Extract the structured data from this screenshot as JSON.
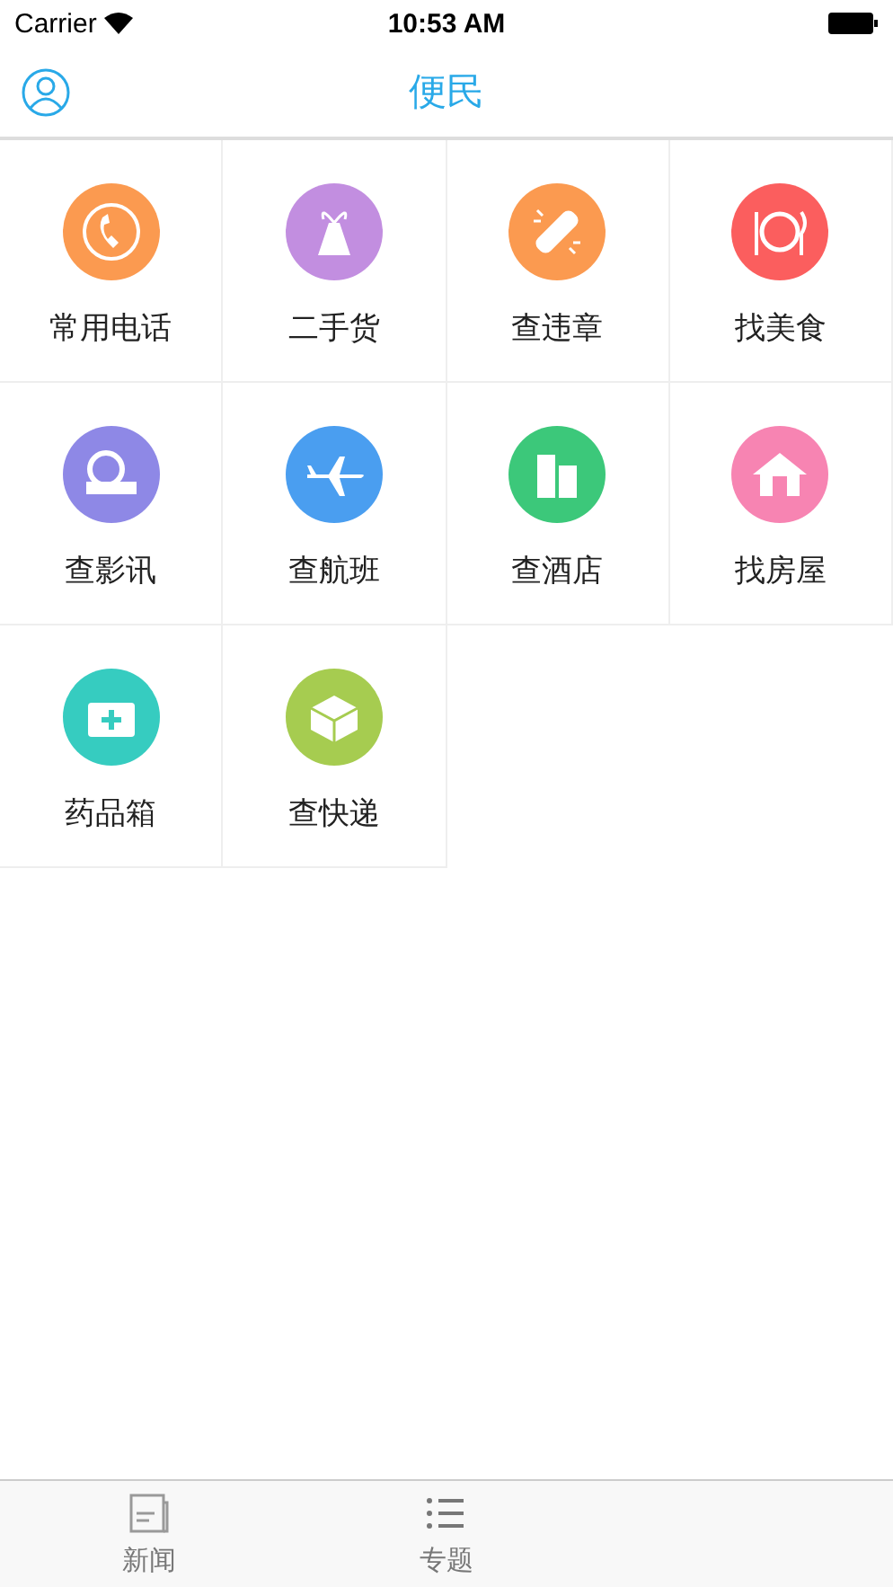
{
  "status_bar": {
    "carrier": "Carrier",
    "time": "10:53 AM"
  },
  "nav_bar": {
    "title": "便民"
  },
  "services": [
    {
      "label": "常用电话",
      "kind": "phone",
      "color": "#fb9a50"
    },
    {
      "label": "二手货",
      "kind": "gift",
      "color": "#c28ee0"
    },
    {
      "label": "查违章",
      "kind": "bandage",
      "color": "#fb9a50"
    },
    {
      "label": "找美食",
      "kind": "dining",
      "color": "#fb5e5e"
    },
    {
      "label": "查影讯",
      "kind": "film",
      "color": "#8e88e6"
    },
    {
      "label": "查航班",
      "kind": "plane",
      "color": "#4a9ef0"
    },
    {
      "label": "查酒店",
      "kind": "hotel",
      "color": "#3cc87a"
    },
    {
      "label": "找房屋",
      "kind": "house",
      "color": "#f784b2"
    },
    {
      "label": "药品箱",
      "kind": "medkit",
      "color": "#36ccc0"
    },
    {
      "label": "查快递",
      "kind": "parcel",
      "color": "#a6cc50"
    }
  ],
  "tab_bar": [
    {
      "label": "新闻",
      "kind": "news"
    },
    {
      "label": "专题",
      "kind": "list"
    }
  ]
}
